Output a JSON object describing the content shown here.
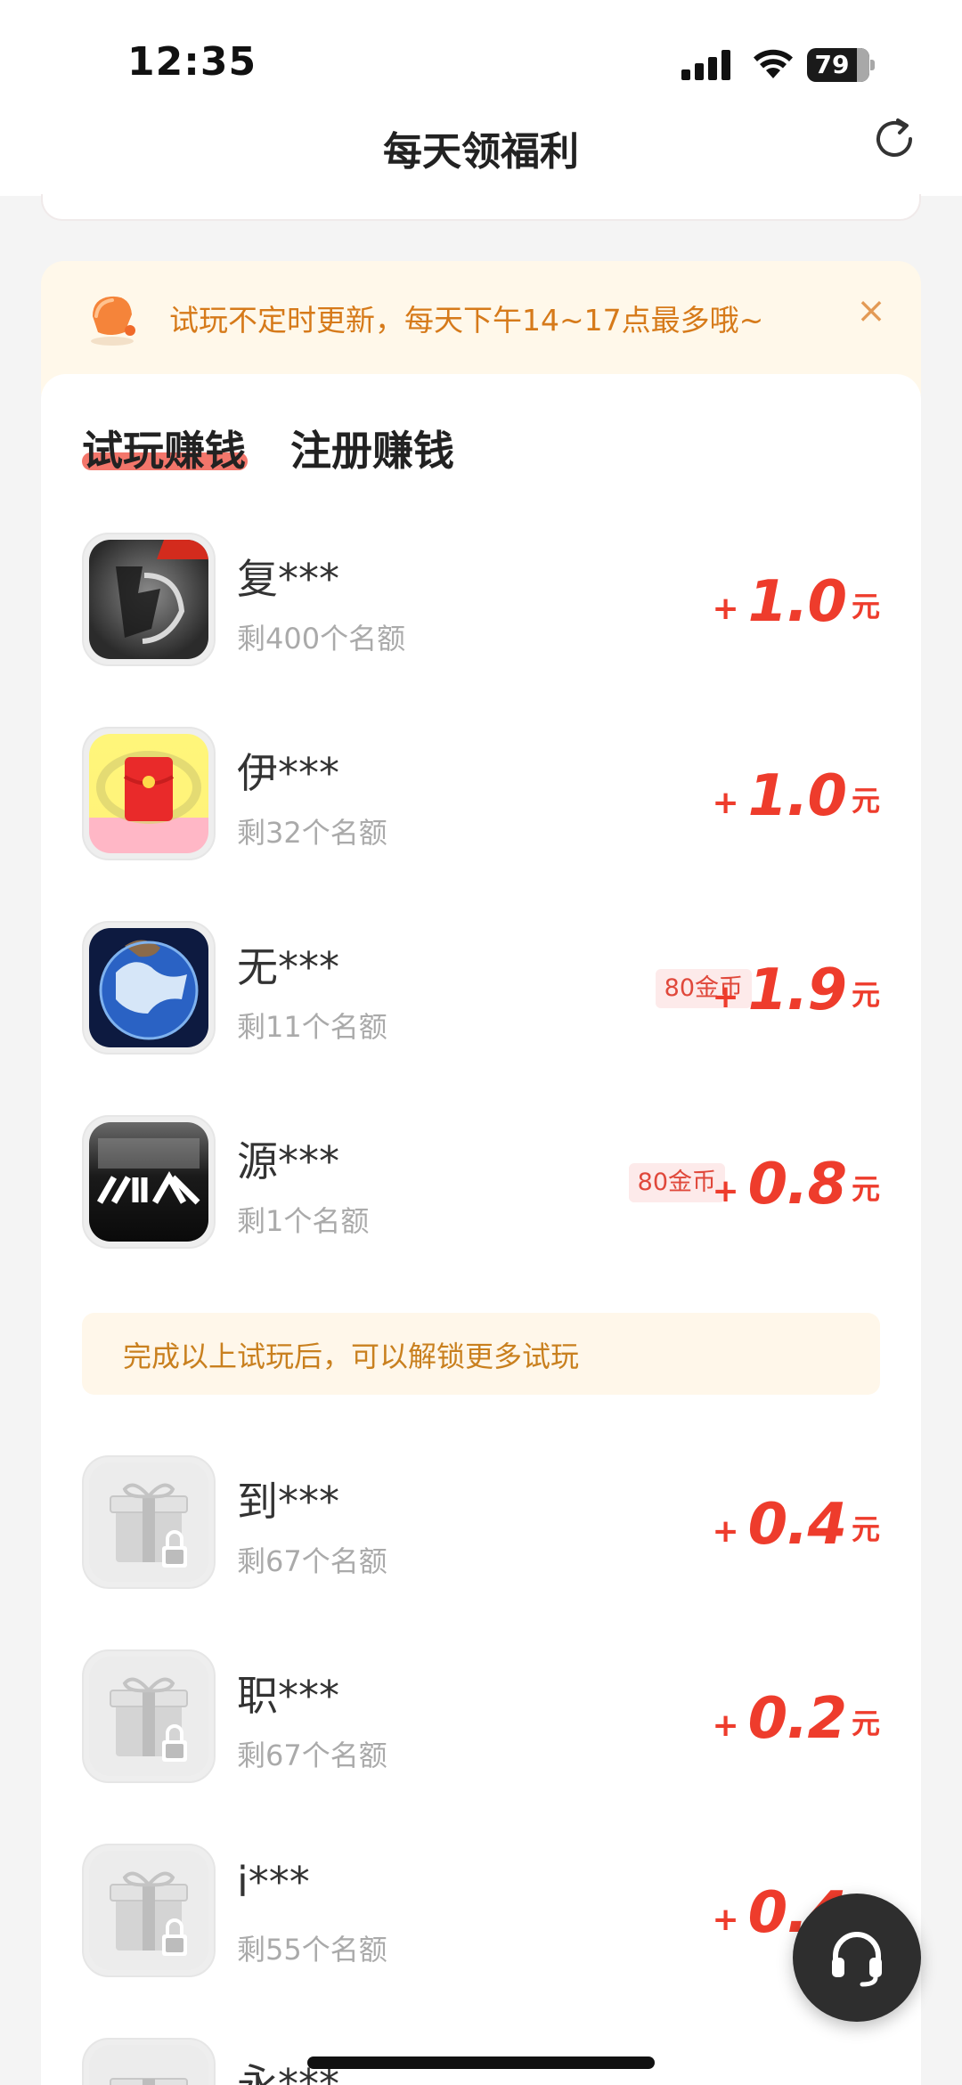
{
  "status_bar": {
    "time": "12:35",
    "battery": "79"
  },
  "nav": {
    "title": "每天领福利"
  },
  "notice": {
    "text": "试玩不定时更新，每天下午14~17点最多哦~",
    "close": "×"
  },
  "tabs": [
    {
      "label": "试玩赚钱",
      "active": true
    },
    {
      "label": "注册赚钱",
      "active": false
    }
  ],
  "tasks": [
    {
      "name": "复***",
      "quota": "剩400个名额",
      "plus": "+",
      "amount": "1.0",
      "unit": "元",
      "icon": "dragon-game-icon",
      "badge_top": ""
    },
    {
      "name": "伊***",
      "quota": "剩32个名额",
      "plus": "+",
      "amount": "1.0",
      "unit": "元",
      "icon": "red-envelope-app-icon"
    },
    {
      "name": "无***",
      "quota": "剩11个名额",
      "coin_badge": "80金币",
      "plus": "+",
      "amount": "1.9",
      "unit": "元",
      "icon": "earth-globe-icon"
    },
    {
      "name": "源***",
      "quota": "剩1个名额",
      "coin_badge": "80金币",
      "plus": "+",
      "amount": "0.8",
      "unit": "元",
      "icon": "dark-logo-app-icon"
    }
  ],
  "unlock_banner": {
    "text": "完成以上试玩后，可以解锁更多试玩"
  },
  "locked_tasks": [
    {
      "name": "到***",
      "quota": "剩67个名额",
      "plus": "+",
      "amount": "0.4",
      "unit": "元",
      "icon": "locked-gift-icon"
    },
    {
      "name": "职***",
      "quota": "剩67个名额",
      "plus": "+",
      "amount": "0.2",
      "unit": "元",
      "icon": "locked-gift-icon"
    },
    {
      "name": "i***",
      "quota": "剩55个名额",
      "plus": "+",
      "amount": "0.4",
      "unit": "元",
      "icon": "locked-gift-icon"
    },
    {
      "name": "永***",
      "icon": "locked-gift-icon"
    }
  ],
  "colors": {
    "accent_red": "#ee3c2c",
    "notice_orange": "#d67a1a",
    "tab_underline": "#f2675b"
  },
  "fab": {
    "icon": "headset-support-icon"
  }
}
